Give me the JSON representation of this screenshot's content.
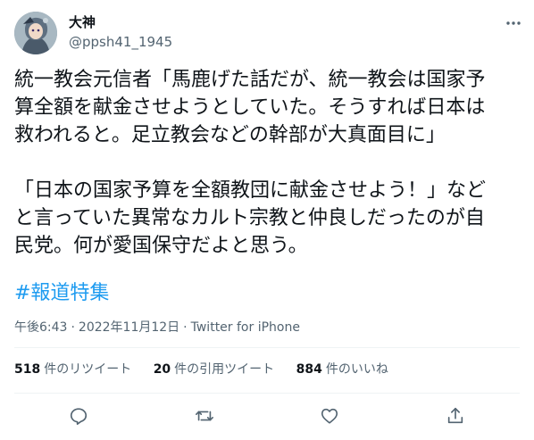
{
  "user": {
    "display_name": "大神",
    "handle": "@ppsh41_1945"
  },
  "tweet": {
    "body": "統一教会元信者「馬鹿げた話だが、統一教会は国家予\n算全額を献金させようとしていた。そうすれば日本は\n救われると。足立教会などの幹部が大真面目に」\n\n「日本の国家予算を全額教団に献金させよう！」など\nと言っていた異常なカルト宗教と仲良しだったのが自\n民党。何が愛国保守だよと思う。",
    "hashtag": "#報道特集"
  },
  "meta": {
    "time": "午後6:43",
    "date": "2022年11月12日",
    "source": "Twitter for iPhone"
  },
  "stats": {
    "retweets_count": "518",
    "retweets_label": "件のリツイート",
    "quotes_count": "20",
    "quotes_label": "件の引用ツイート",
    "likes_count": "884",
    "likes_label": "件のいいね"
  },
  "icons": {
    "more": "more-icon",
    "reply": "reply-icon",
    "retweet": "retweet-icon",
    "like": "like-icon",
    "share": "share-icon"
  },
  "colors": {
    "accent": "#1d9bf0",
    "secondary_text": "#536471",
    "primary_text": "#0f1419"
  }
}
